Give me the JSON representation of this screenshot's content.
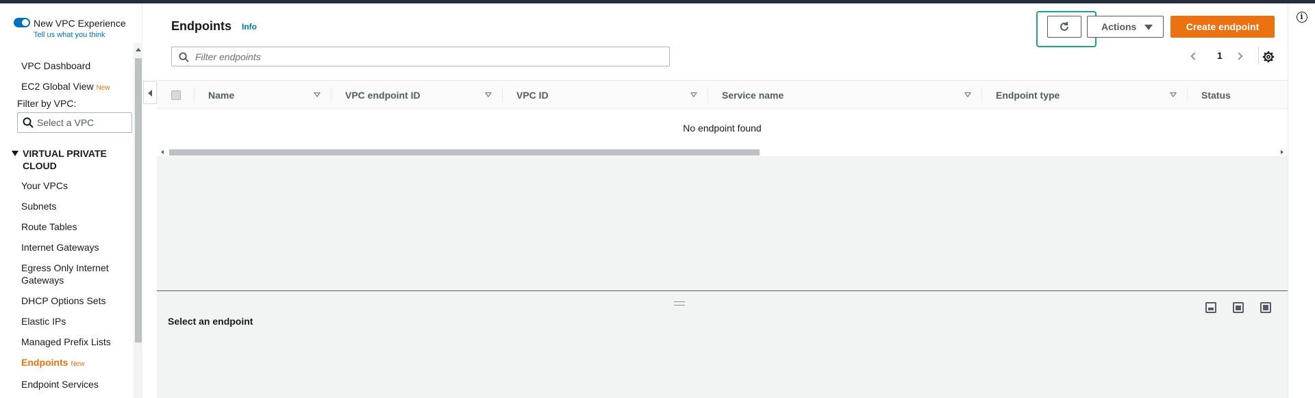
{
  "experience": {
    "title": "New VPC Experience",
    "feedback_link": "Tell us what you think"
  },
  "sidebar": {
    "top_items": [
      {
        "label": "VPC Dashboard"
      },
      {
        "label": "EC2 Global View",
        "badge": "New"
      }
    ],
    "filter_label": "Filter by VPC:",
    "vpc_select_placeholder": "Select a VPC",
    "section_title": "VIRTUAL PRIVATE CLOUD",
    "items": [
      {
        "label": "Your VPCs"
      },
      {
        "label": "Subnets"
      },
      {
        "label": "Route Tables"
      },
      {
        "label": "Internet Gateways"
      },
      {
        "label": "Egress Only Internet Gateways"
      },
      {
        "label": "DHCP Options Sets"
      },
      {
        "label": "Elastic IPs"
      },
      {
        "label": "Managed Prefix Lists"
      },
      {
        "label": "Endpoints",
        "badge": "New",
        "active": true
      },
      {
        "label": "Endpoint Services"
      }
    ]
  },
  "header": {
    "title": "Endpoints",
    "info_link": "Info",
    "actions_label": "Actions",
    "create_label": "Create endpoint"
  },
  "filter": {
    "placeholder": "Filter endpoints"
  },
  "pagination": {
    "current_page": "1"
  },
  "table": {
    "columns": [
      "Name",
      "VPC endpoint ID",
      "VPC ID",
      "Service name",
      "Endpoint type",
      "Status"
    ],
    "empty_message": "No endpoint found"
  },
  "details": {
    "title": "Select an endpoint"
  },
  "colors": {
    "accent_orange": "#ec7211",
    "link_blue": "#0073bb",
    "highlight_teal": "#1fa08a"
  }
}
